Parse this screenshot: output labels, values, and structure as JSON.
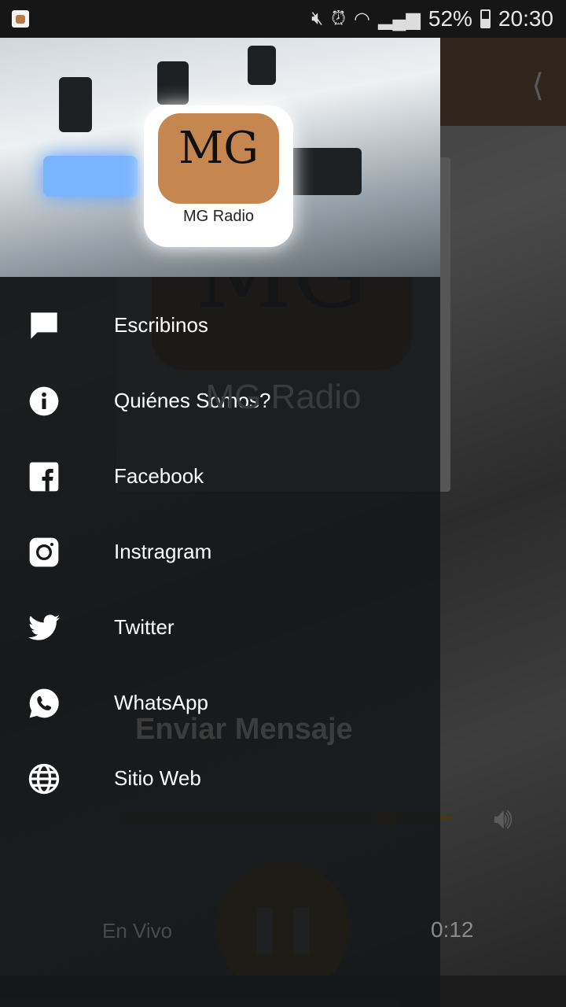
{
  "status_bar": {
    "battery": "52%",
    "battery_level": 0.52,
    "time": "20:30"
  },
  "main": {
    "logo_text": "MG",
    "title": "MG Radio",
    "send_button": "Enviar Mensaje",
    "volume_level": 0.8,
    "live_label": "En Vivo",
    "elapsed": "0:12",
    "accent": "#e8a21a"
  },
  "drawer": {
    "header": {
      "logo_letters": "MG",
      "logo_caption": "MG Radio"
    },
    "items": [
      {
        "label": "Escribinos",
        "icon": "message-icon"
      },
      {
        "label": "Quiénes Somos?",
        "icon": "info-icon"
      },
      {
        "label": "Facebook",
        "icon": "facebook-icon"
      },
      {
        "label": "Instragram",
        "icon": "instagram-icon"
      },
      {
        "label": "Twitter",
        "icon": "twitter-icon"
      },
      {
        "label": "WhatsApp",
        "icon": "whatsapp-icon"
      },
      {
        "label": "Sitio Web",
        "icon": "globe-icon"
      }
    ]
  }
}
